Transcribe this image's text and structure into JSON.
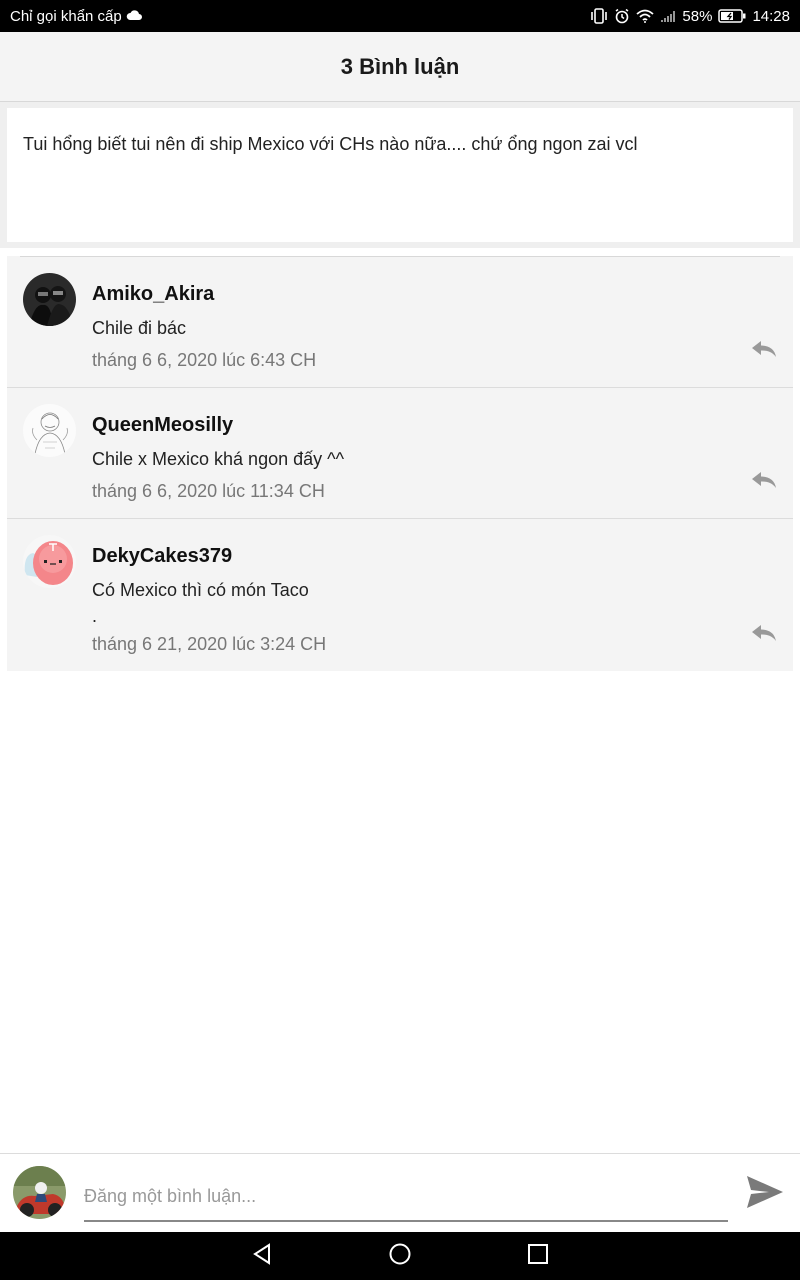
{
  "status_bar": {
    "carrier": "Chỉ gọi khẩn cấp",
    "battery": "58%",
    "time": "14:28"
  },
  "header": {
    "title": "3 Bình luận"
  },
  "post": {
    "text": "Tui hổng biết tui nên đi ship Mexico với CHs nào nữa.... chứ ổng ngon zai vcl"
  },
  "comments": [
    {
      "author": "Amiko_Akira",
      "text": "Chile đi bác",
      "extra": "",
      "time": "tháng 6 6, 2020 lúc 6:43 CH"
    },
    {
      "author": "QueenMeosilly",
      "text": "Chile x Mexico khá ngon đấy ^^",
      "extra": "",
      "time": "tháng 6 6, 2020 lúc 11:34 CH"
    },
    {
      "author": "DekyCakes379",
      "text": "Có Mexico thì có món Taco",
      "extra": ".",
      "time": "tháng 6 21, 2020 lúc 3:24 CH"
    }
  ],
  "compose": {
    "placeholder": "Đăng một bình luận..."
  },
  "colors": {
    "header_bg": "#f4f4f4",
    "comment_bg": "#f4f4f4",
    "meta_text": "#777777"
  }
}
